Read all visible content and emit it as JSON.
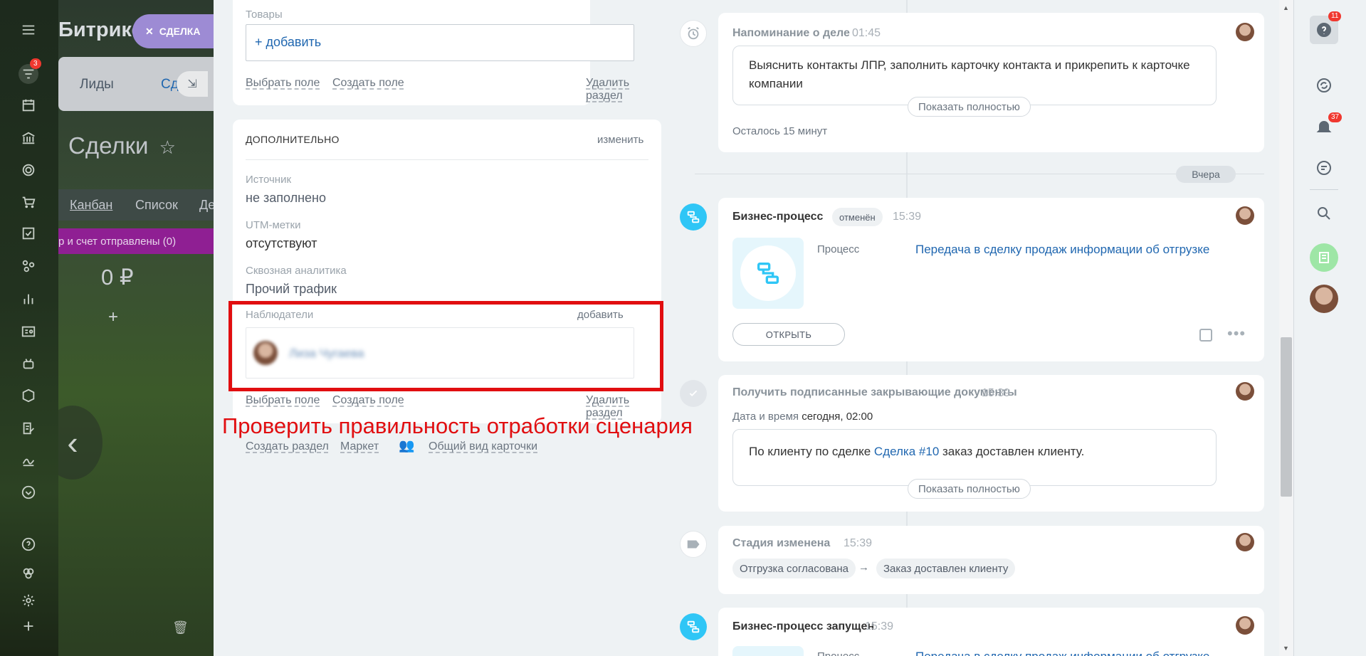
{
  "leftbar": {
    "badge_count": "3"
  },
  "background_crm": {
    "logo": "Битрикс",
    "deal_tab_label": "СДЕЛКА",
    "tab_leads": "Лиды",
    "tab_deals": "Сд",
    "page_title": "Сделки",
    "view_kanban": "Канбан",
    "view_list": "Список",
    "view_other": "Де",
    "stage_name": "р и счет отправлены (0)",
    "stage_sum": "0 ₽",
    "add_symbol": "+"
  },
  "goods_section": {
    "title": "Товары",
    "add_button": "+ добавить",
    "choose_field": "Выбрать поле",
    "create_field": "Создать поле",
    "delete_section": "Удалить раздел"
  },
  "additional_section": {
    "title": "ДОПОЛНИТЕЛЬНО",
    "edit_link": "изменить",
    "fields": [
      {
        "label": "Источник",
        "value": "не заполнено"
      },
      {
        "label": "UTM-метки",
        "value": "отсутствуют"
      },
      {
        "label": "Сквозная аналитика",
        "value": "Прочий трафик"
      }
    ],
    "observers_label": "Наблюдатели",
    "observers_add": "добавить",
    "observer_name": "Лиза Чугаева",
    "choose_field": "Выбрать поле",
    "create_field": "Создать поле",
    "delete_section": "Удалить раздел"
  },
  "bottom_links": {
    "create_section": "Создать раздел",
    "market": "Маркет",
    "common_view": "Общий вид карточки"
  },
  "annotation": "Проверить правильность отработки сценария",
  "timeline": {
    "reminder": {
      "title": "Напоминание о деле",
      "time": "01:45",
      "text": "Выяснить контакты ЛПР, заполнить карточку контакта и прикрепить к карточке компании",
      "show_full": "Показать полностью",
      "remaining": "Осталось 15 минут"
    },
    "day_separator": "Вчера",
    "bp_cancelled": {
      "title": "Бизнес-процесс",
      "status": "отменён",
      "time": "15:39",
      "process_label": "Процесс",
      "process_link": "Передача в сделку продаж информации об отгрузке",
      "open_button": "ОТКРЫТЬ"
    },
    "task": {
      "title": "Получить подписанные закрывающие документы",
      "time": "15:39",
      "datetime_label": "Дата и время",
      "datetime_value": "сегодня, 02:00",
      "text_before": "По клиенту  по сделке",
      "deal_link": "Сделка #10",
      "text_after": "заказ доставлен клиенту.",
      "show_full": "Показать полностью"
    },
    "stage_changed": {
      "title": "Стадия изменена",
      "time": "15:39",
      "from": "Отгрузка согласована",
      "arrow": "→",
      "to": "Заказ доставлен клиенту"
    },
    "bp_started": {
      "title": "Бизнес-процесс запущен",
      "time": "15:39",
      "process_label": "Процесс",
      "process_link": "Передача в сделку продаж информации об отгрузке"
    }
  },
  "rightbar": {
    "help_badge": "11",
    "notifications_badge": "37"
  },
  "colors": {
    "accent_blue": "#2fc6f6",
    "link_blue": "#2067b0",
    "annotation_red": "#e10e10",
    "stage_purple": "#8f1f93"
  }
}
